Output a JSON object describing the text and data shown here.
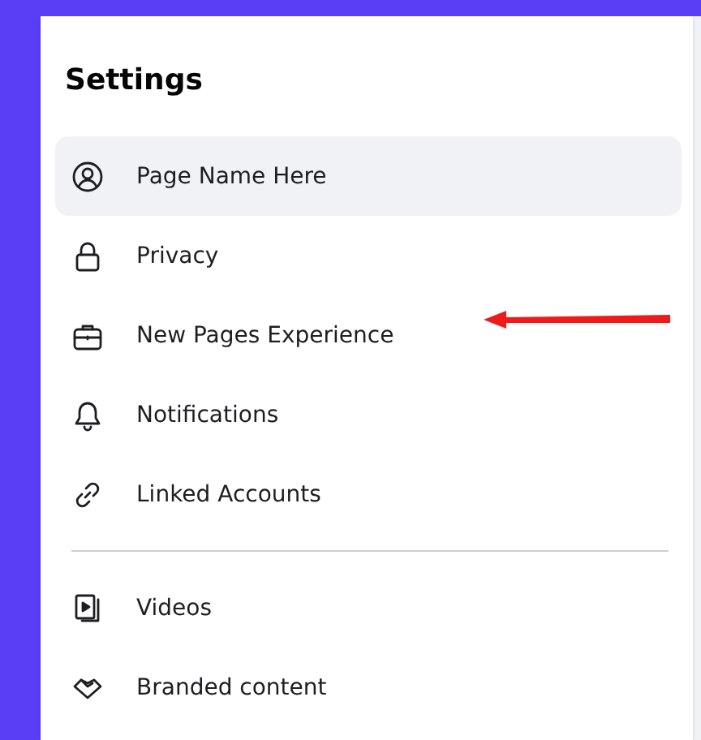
{
  "heading": "Settings",
  "groups": [
    [
      {
        "label": "Page Name Here",
        "selected": true,
        "arrow": false
      },
      {
        "label": "Privacy",
        "selected": false,
        "arrow": false
      },
      {
        "label": "New Pages Experience",
        "selected": false,
        "arrow": true
      },
      {
        "label": "Notifications",
        "selected": false,
        "arrow": false
      },
      {
        "label": "Linked Accounts",
        "selected": false,
        "arrow": false
      }
    ],
    [
      {
        "label": "Videos",
        "selected": false,
        "arrow": false
      },
      {
        "label": "Branded content",
        "selected": false,
        "arrow": false
      }
    ]
  ]
}
